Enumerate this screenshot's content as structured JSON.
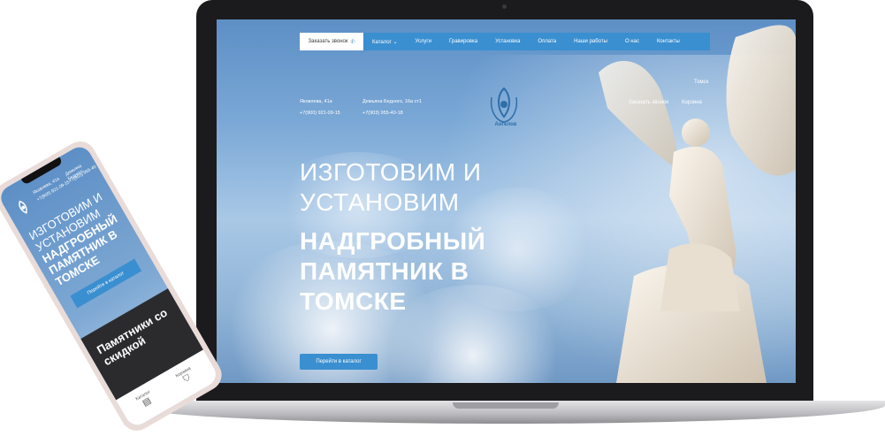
{
  "laptop": {
    "nav": {
      "cta_label": "Заказать звонок",
      "items": [
        "Каталог",
        "Услуги",
        "Гравировка",
        "Установка",
        "Оплата",
        "Наши работы",
        "О нас",
        "Контакты"
      ]
    },
    "addresses": [
      {
        "street": "Яковлева, 41а",
        "phone": "+7(900) 921-09-15"
      },
      {
        "street": "Демьяна Бедного, 16а ст1",
        "phone": "+7(903) 955-40-18"
      }
    ],
    "logo_text": "Ангелов",
    "city": "Томск",
    "order_call": "Заказать звонок",
    "cart": "Корзина",
    "hero_light": [
      "ИЗГОТОВИМ И",
      "УСТАНОВИМ"
    ],
    "hero_bold": [
      "НАДГРОБНЫЙ",
      "ПАМЯТНИК В",
      "ТОМСКЕ"
    ],
    "catalog_button": "Перейти в каталог"
  },
  "phone": {
    "addr1": "Яковлева, 41а",
    "phone1": "+7(900) 921-09-15",
    "addr2": "Демьяна Бедного",
    "phone2": "+7(903) 955-40",
    "hero_light": "ИЗГОТОВИМ И УСТАНОВИМ",
    "hero_bold": "НАДГРОБНЫЙ ПАМЯТНИК В ТОМСКЕ",
    "catalog_button": "Перейти в каталог",
    "promo_title_1": "Памятники со",
    "promo_title_2": "скидкой",
    "tab_catalog": "Каталог",
    "tab_cart": "Корзина"
  },
  "colors": {
    "accent": "#3a8fd0",
    "sky_top": "#5d8fc6",
    "laptop_frame": "#1b1b1d"
  }
}
